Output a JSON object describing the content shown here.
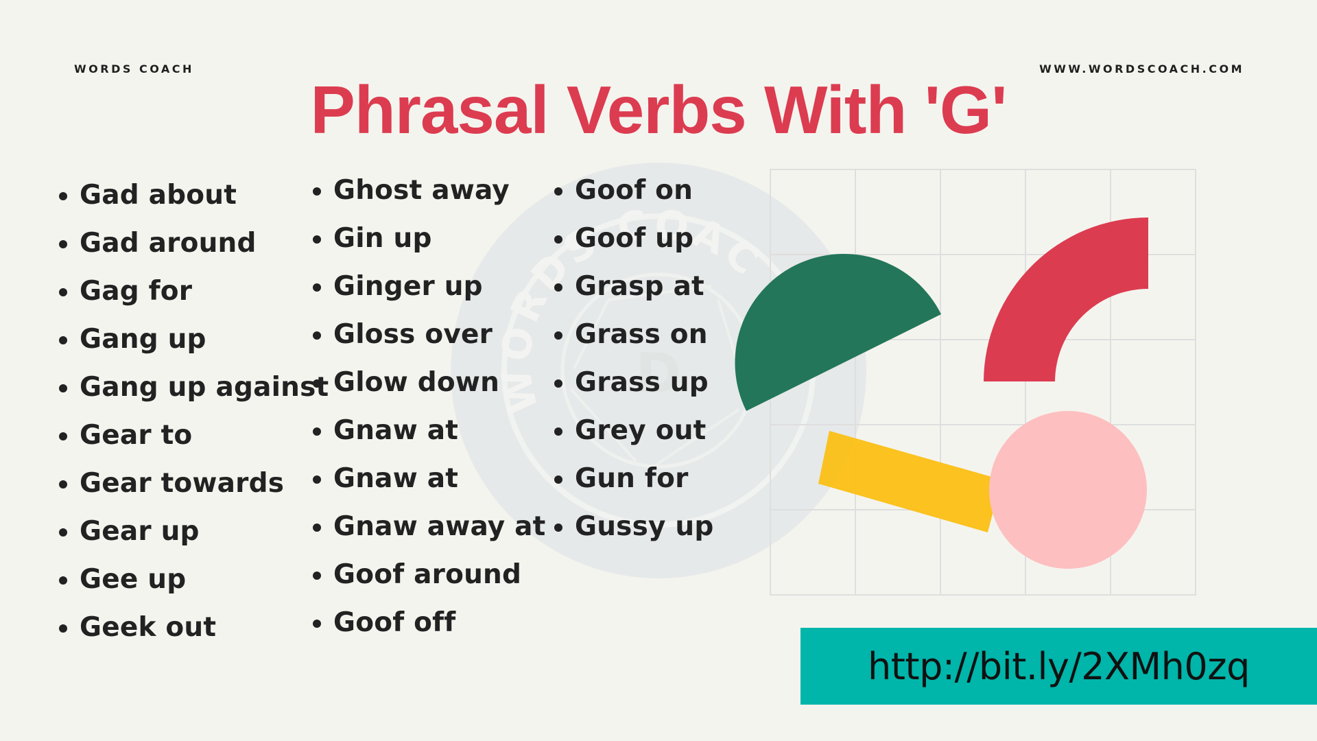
{
  "header": {
    "brand_left": "WORDS COACH",
    "brand_right": "WWW.WORDSCOACH.COM",
    "title": "Phrasal Verbs With 'G'"
  },
  "columns": [
    {
      "items": [
        "Gad about",
        "Gad around",
        "Gag for",
        "Gang up",
        "Gang up against",
        "Gear to",
        "Gear towards",
        "Gear up",
        "Gee up",
        "Geek out"
      ]
    },
    {
      "items": [
        "Ghost away",
        "Gin up",
        "Ginger up",
        "Gloss over",
        "Glow down",
        "Gnaw at",
        "Gnaw at",
        "Gnaw away at",
        "Goof around",
        "Goof off"
      ]
    },
    {
      "items": [
        "Goof on",
        "Goof up",
        "Grasp at",
        "Grass on",
        "Grass up",
        "Grey out",
        "Gun for",
        "Gussy up"
      ]
    }
  ],
  "watermark": {
    "text": "WORDS COACH",
    "letter": "D"
  },
  "footer": {
    "link": "http://bit.ly/2XMh0zq"
  },
  "colors": {
    "background": "#f4f4ef",
    "title": "#dc3c50",
    "text": "#222222",
    "banner": "#00b5aa",
    "green_shape": "#1f7356",
    "red_shape": "#dc3c50",
    "yellow_shape": "#fbbf17",
    "pink_shape": "#fdbfbf",
    "grid": "#dedede",
    "watermark": "#e6e9e9"
  }
}
